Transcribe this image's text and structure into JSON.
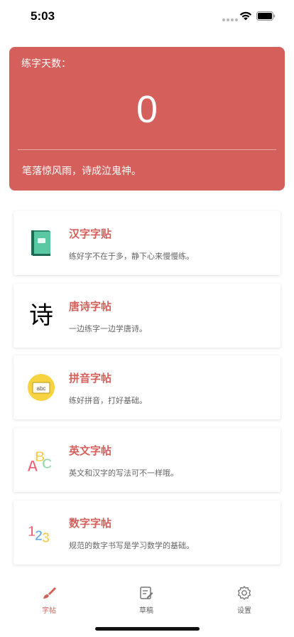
{
  "status_bar": {
    "time": "5:03"
  },
  "hero": {
    "label": "练字天数：",
    "count": "0",
    "motto": "笔落惊风雨，诗成泣鬼神。"
  },
  "cards": [
    {
      "icon": "book-icon",
      "title": "汉字字贴",
      "desc": "练好字不在于多，静下心来慢慢练。"
    },
    {
      "icon": "poem-character-icon",
      "title": "唐诗字帖",
      "desc": "一边练字一边学唐诗。",
      "glyph": "诗"
    },
    {
      "icon": "abc-board-icon",
      "title": "拼音字帖",
      "desc": "练好拼音，打好基础。",
      "glyph": "abc"
    },
    {
      "icon": "abc-letters-icon",
      "title": "英文字帖",
      "desc": "英文和汉字的写法可不一样哦。"
    },
    {
      "icon": "123-numbers-icon",
      "title": "数字字帖",
      "desc": "规范的数字书写是学习数学的基础。"
    }
  ],
  "tabs": [
    {
      "icon": "brush-icon",
      "label": "字帖",
      "active": true
    },
    {
      "icon": "draft-icon",
      "label": "草稿",
      "active": false
    },
    {
      "icon": "settings-gear-icon",
      "label": "设置",
      "active": false
    }
  ],
  "colors": {
    "accent": "#d55f5a",
    "hero_bg": "#d55f5a"
  }
}
